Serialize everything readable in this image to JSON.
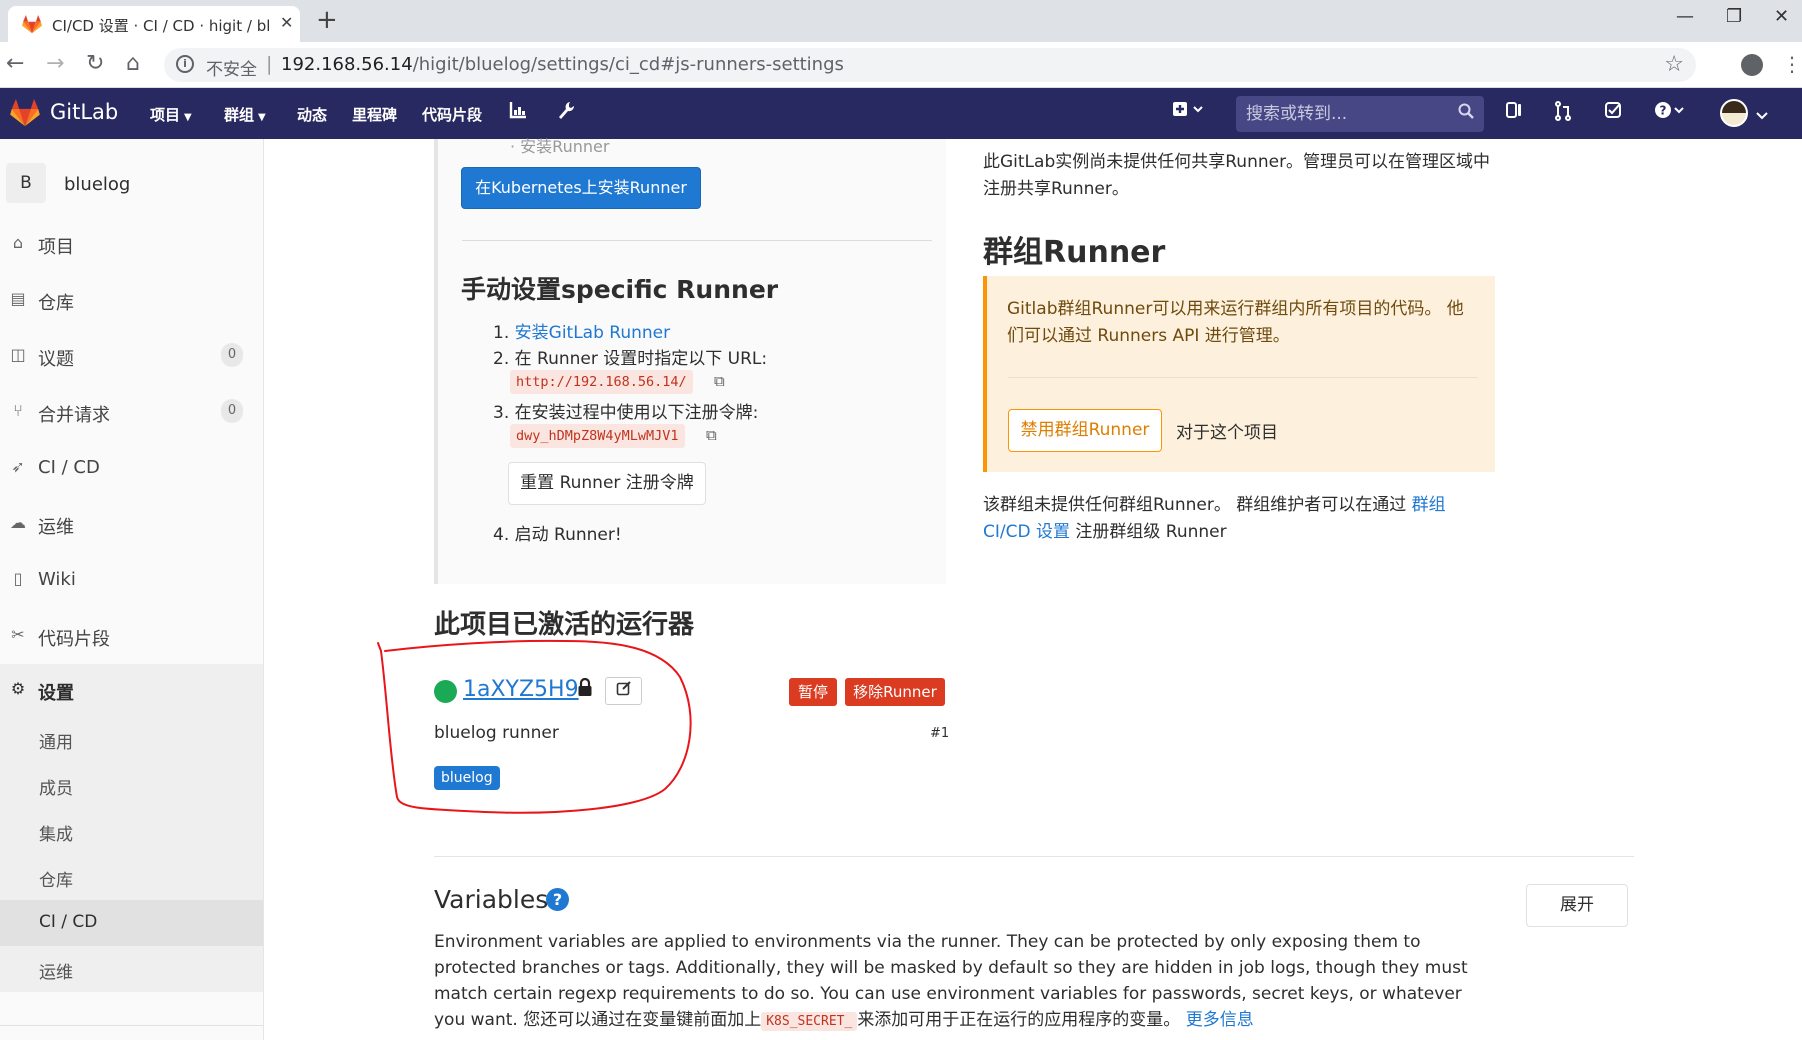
{
  "browser": {
    "tab_title": "CI/CD 设置 · CI / CD · higit / bl",
    "new_tab": "+",
    "omnibox_insecure": "不安全",
    "omnibox_sep": "|",
    "url_host": "192.168.56.14",
    "url_rest": "/higit/bluelog/settings/ci_cd#js-runners-settings"
  },
  "header": {
    "brand": "GitLab",
    "nav": [
      "项目",
      "群组",
      "动态",
      "里程碑",
      "代码片段"
    ],
    "search_placeholder": "搜索或转到..."
  },
  "sidebar": {
    "project_initial": "B",
    "project_name": "bluelog",
    "items": [
      {
        "label": "项目"
      },
      {
        "label": "仓库"
      },
      {
        "label": "议题",
        "count": "0"
      },
      {
        "label": "合并请求",
        "count": "0"
      },
      {
        "label": "CI / CD"
      },
      {
        "label": "运维"
      },
      {
        "label": "Wiki"
      },
      {
        "label": "代码片段"
      },
      {
        "label": "设置"
      }
    ],
    "sub_items": [
      "通用",
      "成员",
      "集成",
      "仓库",
      "CI / CD",
      "运维"
    ]
  },
  "specific": {
    "cut_text": "· 安装Runner",
    "k8s_button": "在Kubernetes上安装Runner",
    "manual_title": "手动设置specific Runner",
    "step1_num": "1.",
    "step1_link": "安装GitLab Runner",
    "step2": "2. 在 Runner 设置时指定以下 URL:",
    "url": "http://192.168.56.14/",
    "step3": "3. 在安装过程中使用以下注册令牌:",
    "token": "dwy_hDMpZ8W4yMLwMJV1",
    "reset_button": "重置 Runner 注册令牌",
    "step4": "4. 启动 Runner!"
  },
  "active": {
    "title": "此项目已激活的运行器",
    "runner_id": "1aXYZ5H9",
    "pause_button": "暂停",
    "remove_button": "移除Runner",
    "description": "bluelog runner",
    "number": "#1",
    "tag": "bluelog"
  },
  "shared": {
    "text": "此GitLab实例尚未提供任何共享Runner。管理员可以在管理区域中注册共享Runner。"
  },
  "group": {
    "title": "群组Runner",
    "alert_text": "Gitlab群组Runner可以用来运行群组内所有项目的代码。 他们可以通过 Runners API 进行管理。",
    "disable_button": "禁用群组Runner",
    "for_project": "对于这个项目",
    "none_text": "该群组未提供任何群组Runner。 群组维护者可以在通过 ",
    "none_link": "群组 CI/CD 设置",
    "none_suffix": " 注册群组级 Runner"
  },
  "variables": {
    "title": "Variables",
    "help": "?",
    "expand_button": "展开",
    "desc": "Environment variables are applied to environments via the runner. They can be protected by only exposing them to protected branches or tags. Additionally, they will be masked by default so they are hidden in job logs, though they must match certain regexp requirements to do so. You can use environment variables for passwords, secret keys, or whatever you want. 您还可以通过在变量键前面加上",
    "code": "K8S_SECRET_",
    "desc_suffix": "来添加可用于正在运行的应用程序的变量。 ",
    "more_link": "更多信息"
  },
  "colors": {
    "header_bg": "#292961",
    "link": "#1f78d1",
    "danger": "#db3b21",
    "success": "#1aaa55",
    "warning": "#fc9403"
  }
}
